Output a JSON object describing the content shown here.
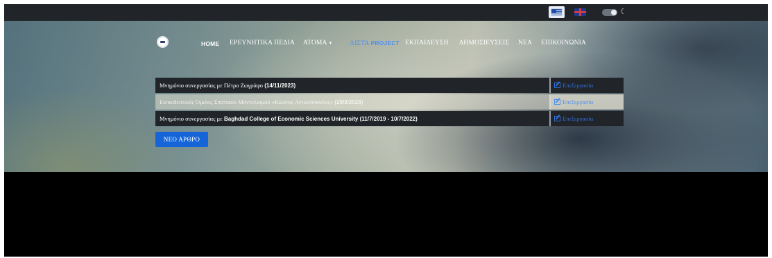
{
  "topbar": {
    "languages": [
      {
        "icon": "greek-flag-icon",
        "active": true
      },
      {
        "icon": "uk-flag-icon",
        "active": false
      }
    ],
    "theme_toggle_icon": "toggle-switch-icon",
    "theme_icon_glyph": "☾"
  },
  "nav": {
    "items": [
      {
        "label": "HOME",
        "active": false
      },
      {
        "label": "ΕΡΕΥΝΗΤΙΚΑ ΠΕΔΙΑ",
        "active": false
      },
      {
        "label": "ΑΤΟΜΑ",
        "active": false,
        "has_dropdown": true
      },
      {
        "label": "ΛΙΣΤΑ",
        "label_suffix": "PROJECT",
        "active": true
      },
      {
        "label": "ΕΚΠΑΙΔΕΥΣΗ",
        "active": false
      },
      {
        "label": "ΔΗΜΟΣΙΕΥΣΕΙΣ",
        "active": false
      },
      {
        "label": "ΝΕΑ",
        "active": false
      },
      {
        "label": "ΕΠΙΚΟΙΝΩΝΙΑ",
        "active": false
      }
    ],
    "dropdown_glyph": "▾"
  },
  "projects": {
    "rows": [
      {
        "title": "Μνημόνιο συνεργασίας με Πέτρο Ζωγράφο",
        "title_bold": " (14/11/2023)",
        "edit_label": "Επεξεργασία"
      },
      {
        "title": "Εκπαιδευτικός Όμιλος Σπατιαού Μοντελισμού «Κώστας Αντωνόπουλος»",
        "title_bold": " (25/3/2023)",
        "edit_label": "Επεξεργασία"
      },
      {
        "title": "Μνημόνιο συνεργασίας με",
        "title_bold": " Baghdad College of Economic Sciences University (11/7/2019 - 10/7/2022)",
        "edit_label": "Επεξεργασία"
      }
    ],
    "new_button_label": "ΝΕΟ ΑΡΘΡΟ"
  },
  "colors": {
    "accent": "#1565d8",
    "active_nav": "#4f8ff0",
    "topbar": "#212529"
  }
}
